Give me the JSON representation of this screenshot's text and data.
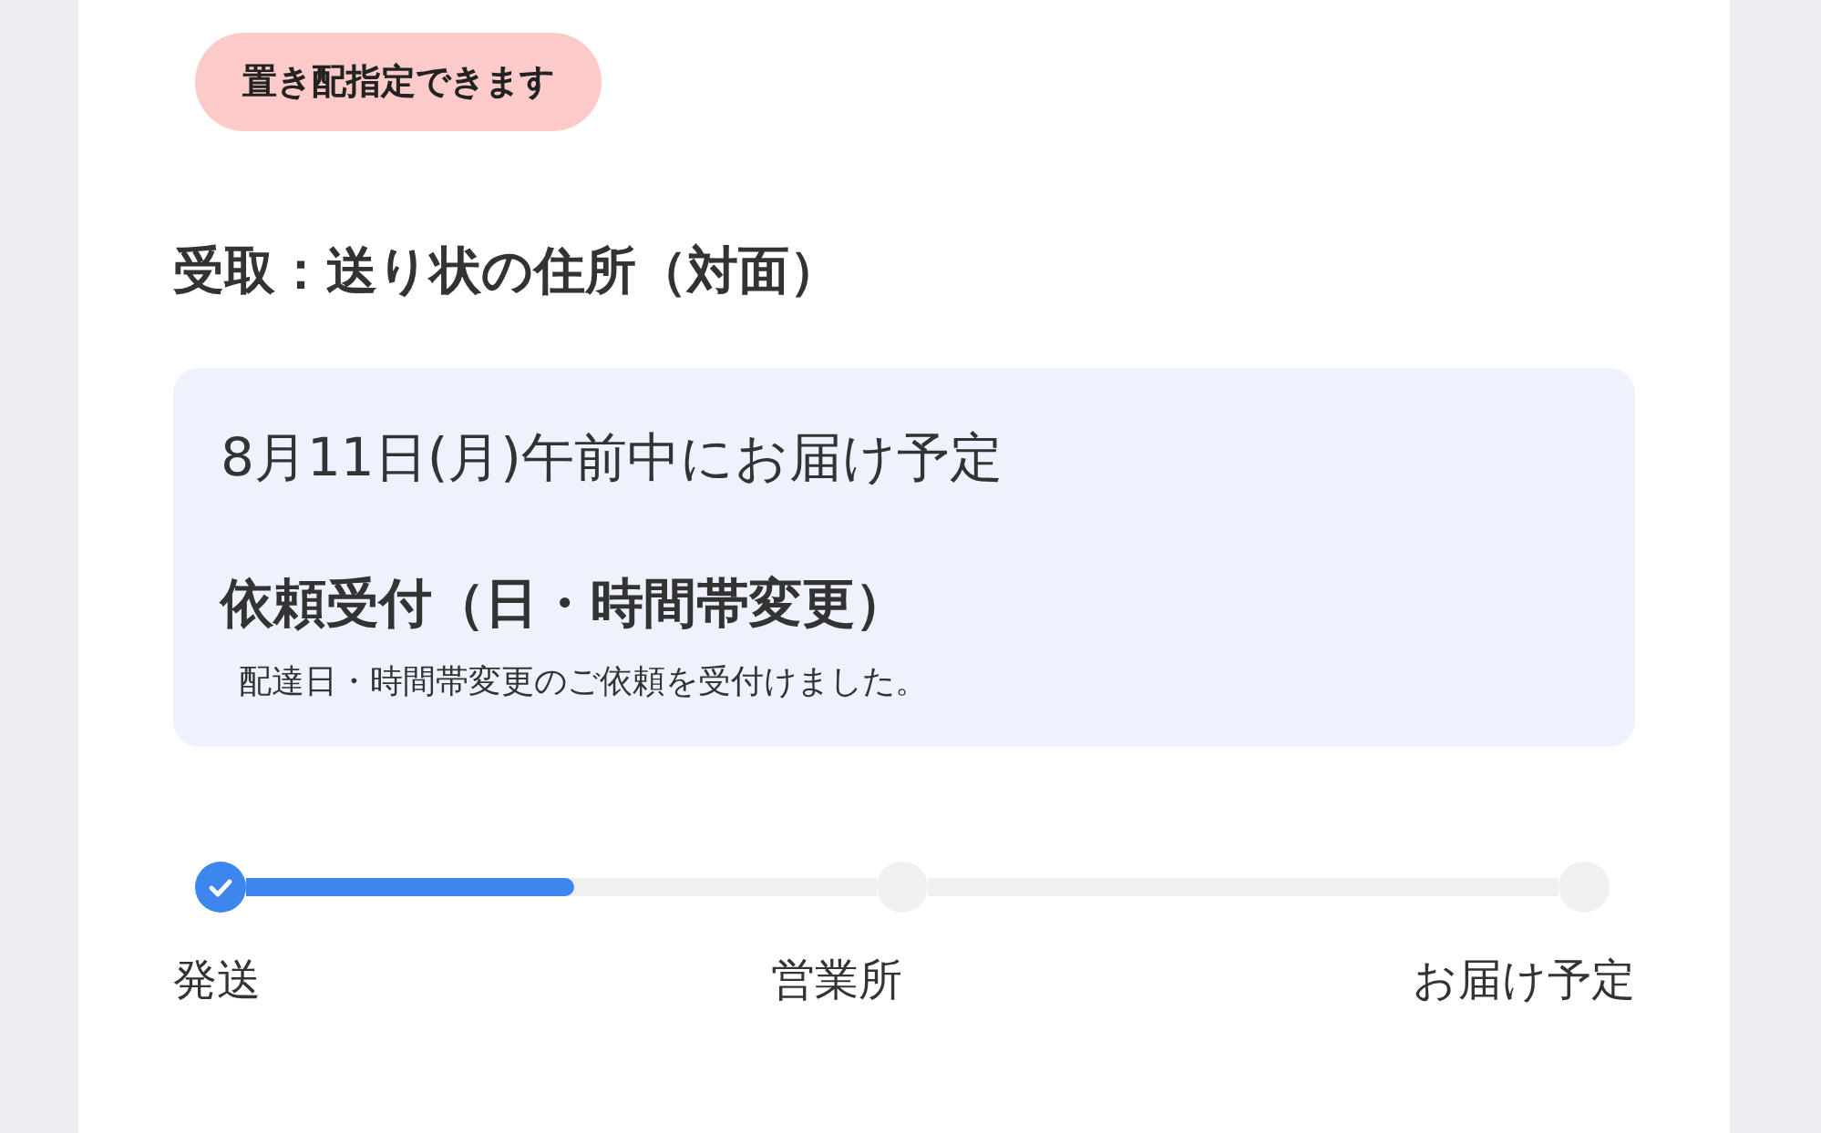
{
  "badge": "置き配指定できます",
  "receipt": "受取：送り状の住所（対面）",
  "delivery": {
    "date": "8月11日(月)午前中にお届け予定",
    "status": "依頼受付（日・時間帯変更）",
    "note": "配達日・時間帯変更のご依頼を受付けました。"
  },
  "progress": {
    "steps": [
      {
        "label": "発送",
        "done": true,
        "level": 0.52
      },
      {
        "label": "営業所",
        "done": false
      },
      {
        "label": "お届け予定",
        "done": false
      }
    ]
  }
}
